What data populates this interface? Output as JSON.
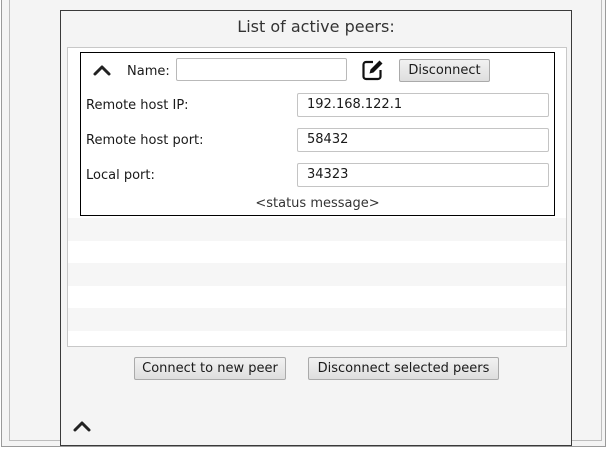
{
  "panel": {
    "title": "List of active peers:"
  },
  "peer": {
    "collapse_icon": "chevron-up-icon",
    "name_label": "Name:",
    "name_value": "",
    "edit_icon": "edit-square-icon",
    "disconnect_label": "Disconnect",
    "rows": [
      {
        "label": "Remote host IP:",
        "value": "192.168.122.1"
      },
      {
        "label": "Remote host port:",
        "value": "58432"
      },
      {
        "label": "Local port:",
        "value": "34323"
      }
    ],
    "status": "<status message>"
  },
  "actions": {
    "connect_label": "Connect to new peer",
    "disconnect_selected_label": "Disconnect selected peers"
  },
  "footer": {
    "collapse_icon": "chevron-up-icon"
  }
}
